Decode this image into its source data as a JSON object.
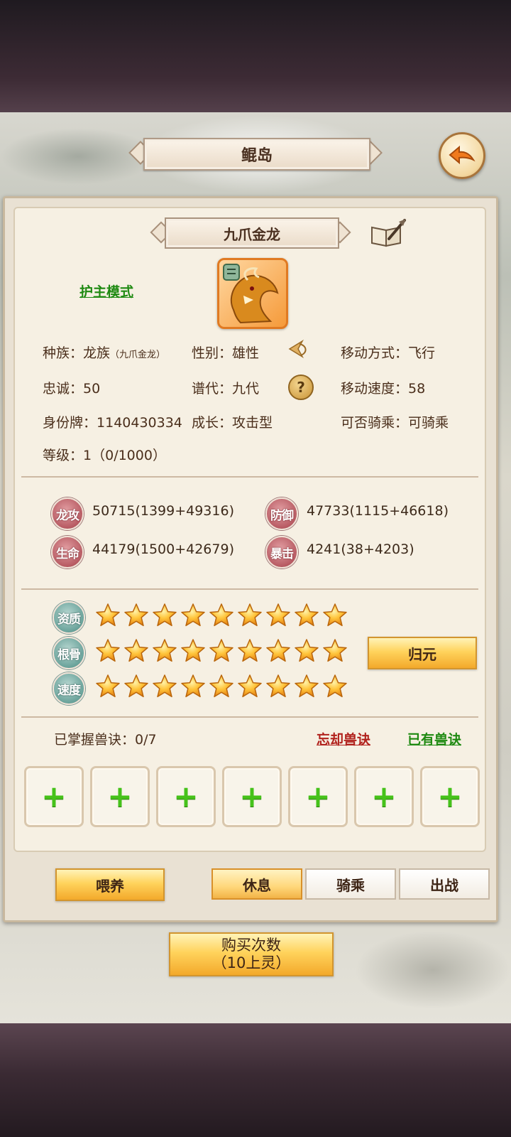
{
  "header": {
    "title": "鲲岛"
  },
  "pet": {
    "name": "九爪金龙",
    "mode_link": "护主模式",
    "info": {
      "species_label": "种族：",
      "species_value": "龙族",
      "species_sub": "（九爪金龙）",
      "gender_label": "性别：",
      "gender_value": "雄性",
      "move_label": "移动方式：",
      "move_value": "飞行",
      "loyalty_label": "忠诚：",
      "loyalty_value": "50",
      "generation_label": "谱代：",
      "generation_value": "九代",
      "speed_label": "移动速度：",
      "speed_value": "58",
      "id_label": "身份牌：",
      "id_value": "1140430334",
      "growth_label": "成长：",
      "growth_value": "攻击型",
      "ride_label": "可否骑乘：",
      "ride_value": "可骑乘",
      "level_label": "等级：",
      "level_value": "1（0/1000）"
    }
  },
  "stats": [
    {
      "label": "龙攻",
      "value": "50715(1399+49316)"
    },
    {
      "label": "防御",
      "value": "47733(1115+46618)"
    },
    {
      "label": "生命",
      "value": "44179(1500+42679)"
    },
    {
      "label": "暴击",
      "value": "4241(38+4203)"
    }
  ],
  "aptitudes": [
    {
      "label": "资质",
      "stars": 9
    },
    {
      "label": "根骨",
      "stars": 9
    },
    {
      "label": "速度",
      "stars": 9
    }
  ],
  "reset_button": "归元",
  "skills": {
    "mastered_label": "已掌握兽诀：0/7",
    "forget_link": "忘却兽诀",
    "owned_link": "已有兽诀",
    "slots": 7
  },
  "actions": {
    "feed": "喂养",
    "rest": "休息",
    "ride": "骑乘",
    "battle": "出战"
  },
  "buy_button": {
    "line1": "购买次数",
    "line2": "（10上灵）"
  },
  "colors": {
    "accent_gold": "#ffd35c",
    "link_green": "#1f8a12",
    "link_red": "#b1221d",
    "plus_green": "#46c21a"
  }
}
